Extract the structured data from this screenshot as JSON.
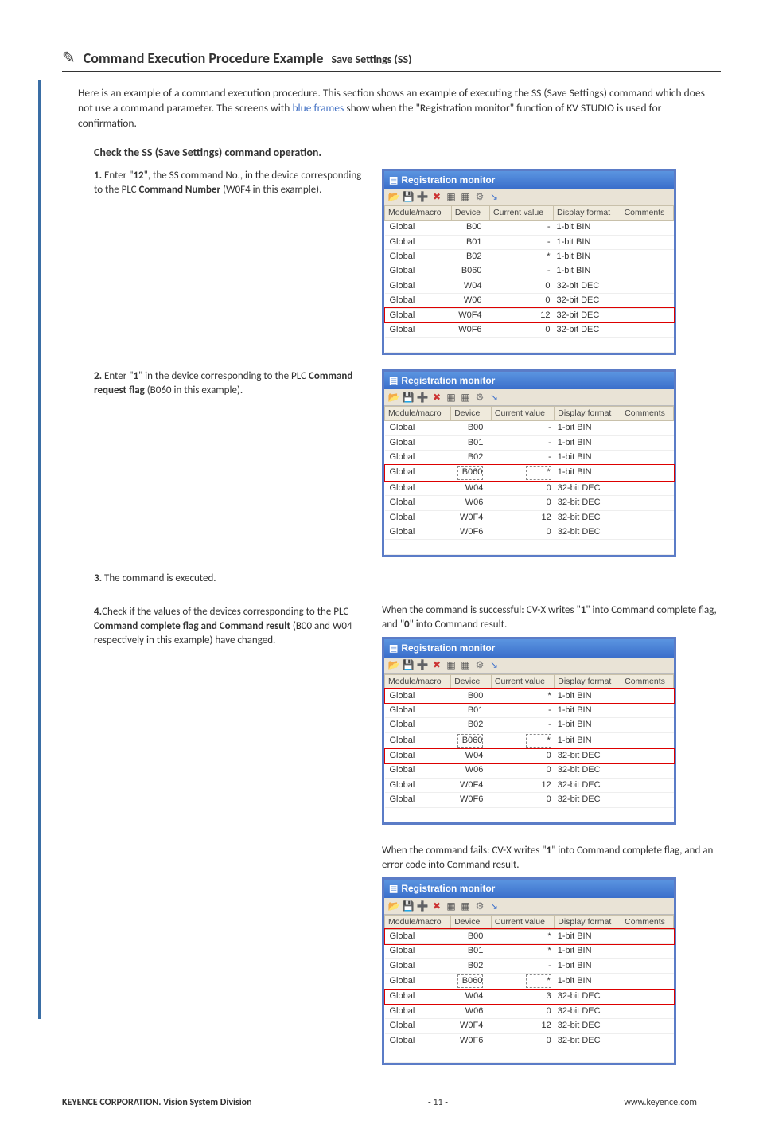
{
  "header": {
    "title": "Command Execution Procedure Example",
    "sub": "Save Settings (SS)"
  },
  "intro_1": "Here is an example of a command execution procedure. This section shows an example of executing the SS (Save Settings) command which does not use a command parameter. The screens with ",
  "intro_blue": "blue frames",
  "intro_2": " show when the \"Registration monitor\" function of KV STUDIO is used for confirmation.",
  "section_title": "Check the SS (Save Settings) command operation.",
  "step1_pre": "1.",
  "step1_a": " Enter \"",
  "step1_b": "12",
  "step1_c": "\", the SS command No., in the device corresponding to the PLC ",
  "step1_d": "Command Number",
  "step1_e": " (W0F4 in this example).",
  "step2_pre": "2.",
  "step2_a": " Enter \"",
  "step2_b": "1",
  "step2_c": "\" in the device corresponding to the PLC ",
  "step2_d": "Command request flag",
  "step2_e": " (B060 in this example).",
  "step3_pre": "3.",
  "step3_a": " The command is executed.",
  "step4_pre": "4.",
  "step4_a": "Check if the values of the devices corresponding to the PLC ",
  "step4_b": "Command complete flag and Command result",
  "step4_c": " (B00 and W04 respectively in this example) have changed.",
  "success_a": "When the command is successful: CV-X writes \"",
  "success_b": "1",
  "success_c": "\" into Command complete flag, and \"",
  "success_d": "0",
  "success_e": "\" into Command result.",
  "fail_a": "When the command fails: CV-X writes \"",
  "fail_b": "1",
  "fail_c": "\" into Command complete flag, and an error code into Command result.",
  "reg_title": "Registration monitor",
  "reg_headers": {
    "mm": "Module/macro",
    "dev": "Device",
    "cv": "Current value",
    "df": "Display format",
    "cm": "Comments"
  },
  "table1": [
    {
      "mod": "Global",
      "dev": "B00",
      "cv": "-",
      "df": "1-bit BIN",
      "hl": false
    },
    {
      "mod": "Global",
      "dev": "B01",
      "cv": "-",
      "df": "1-bit BIN",
      "hl": false
    },
    {
      "mod": "Global",
      "dev": "B02",
      "cv": "*",
      "df": "1-bit BIN",
      "hl": false
    },
    {
      "mod": "Global",
      "dev": "B060",
      "cv": "-",
      "df": "1-bit BIN",
      "hl": false
    },
    {
      "mod": "Global",
      "dev": "W04",
      "cv": "0",
      "df": "32-bit DEC",
      "hl": false
    },
    {
      "mod": "Global",
      "dev": "W06",
      "cv": "0",
      "df": "32-bit DEC",
      "hl": false
    },
    {
      "mod": "Global",
      "dev": "W0F4",
      "cv": "12",
      "df": "32-bit DEC",
      "hl": true
    },
    {
      "mod": "Global",
      "dev": "W0F6",
      "cv": "0",
      "df": "32-bit DEC",
      "hl": false
    }
  ],
  "table2": [
    {
      "mod": "Global",
      "dev": "B00",
      "cv": "-",
      "df": "1-bit BIN",
      "hl": false
    },
    {
      "mod": "Global",
      "dev": "B01",
      "cv": "-",
      "df": "1-bit BIN",
      "hl": false
    },
    {
      "mod": "Global",
      "dev": "B02",
      "cv": "-",
      "df": "1-bit BIN",
      "hl": false
    },
    {
      "mod": "Global",
      "dev": "B060",
      "cv": "*",
      "df": "1-bit BIN",
      "hl": true,
      "dashed": true
    },
    {
      "mod": "Global",
      "dev": "W04",
      "cv": "0",
      "df": "32-bit DEC",
      "hl": false
    },
    {
      "mod": "Global",
      "dev": "W06",
      "cv": "0",
      "df": "32-bit DEC",
      "hl": false
    },
    {
      "mod": "Global",
      "dev": "W0F4",
      "cv": "12",
      "df": "32-bit DEC",
      "hl": false
    },
    {
      "mod": "Global",
      "dev": "W0F6",
      "cv": "0",
      "df": "32-bit DEC",
      "hl": false
    }
  ],
  "table3": [
    {
      "mod": "Global",
      "dev": "B00",
      "cv": "*",
      "df": "1-bit BIN",
      "hl": true
    },
    {
      "mod": "Global",
      "dev": "B01",
      "cv": "-",
      "df": "1-bit BIN",
      "hl": false
    },
    {
      "mod": "Global",
      "dev": "B02",
      "cv": "-",
      "df": "1-bit BIN",
      "hl": false
    },
    {
      "mod": "Global",
      "dev": "B060",
      "cv": "*",
      "df": "1-bit BIN",
      "hl": false,
      "dashed": true
    },
    {
      "mod": "Global",
      "dev": "W04",
      "cv": "0",
      "df": "32-bit DEC",
      "hl": true
    },
    {
      "mod": "Global",
      "dev": "W06",
      "cv": "0",
      "df": "32-bit DEC",
      "hl": false
    },
    {
      "mod": "Global",
      "dev": "W0F4",
      "cv": "12",
      "df": "32-bit DEC",
      "hl": false
    },
    {
      "mod": "Global",
      "dev": "W0F6",
      "cv": "0",
      "df": "32-bit DEC",
      "hl": false
    }
  ],
  "table4": [
    {
      "mod": "Global",
      "dev": "B00",
      "cv": "*",
      "df": "1-bit BIN",
      "hl": true
    },
    {
      "mod": "Global",
      "dev": "B01",
      "cv": "*",
      "df": "1-bit BIN",
      "hl": false
    },
    {
      "mod": "Global",
      "dev": "B02",
      "cv": "-",
      "df": "1-bit BIN",
      "hl": false
    },
    {
      "mod": "Global",
      "dev": "B060",
      "cv": "*",
      "df": "1-bit BIN",
      "hl": false,
      "dashed": true
    },
    {
      "mod": "Global",
      "dev": "W04",
      "cv": "3",
      "df": "32-bit DEC",
      "hl": true
    },
    {
      "mod": "Global",
      "dev": "W06",
      "cv": "0",
      "df": "32-bit DEC",
      "hl": false
    },
    {
      "mod": "Global",
      "dev": "W0F4",
      "cv": "12",
      "df": "32-bit DEC",
      "hl": false
    },
    {
      "mod": "Global",
      "dev": "W0F6",
      "cv": "0",
      "df": "32-bit DEC",
      "hl": false
    }
  ],
  "footer": {
    "left": "KEYENCE CORPORATION. Vision System Division",
    "center": "- 11 -",
    "right": "www.keyence.com"
  }
}
